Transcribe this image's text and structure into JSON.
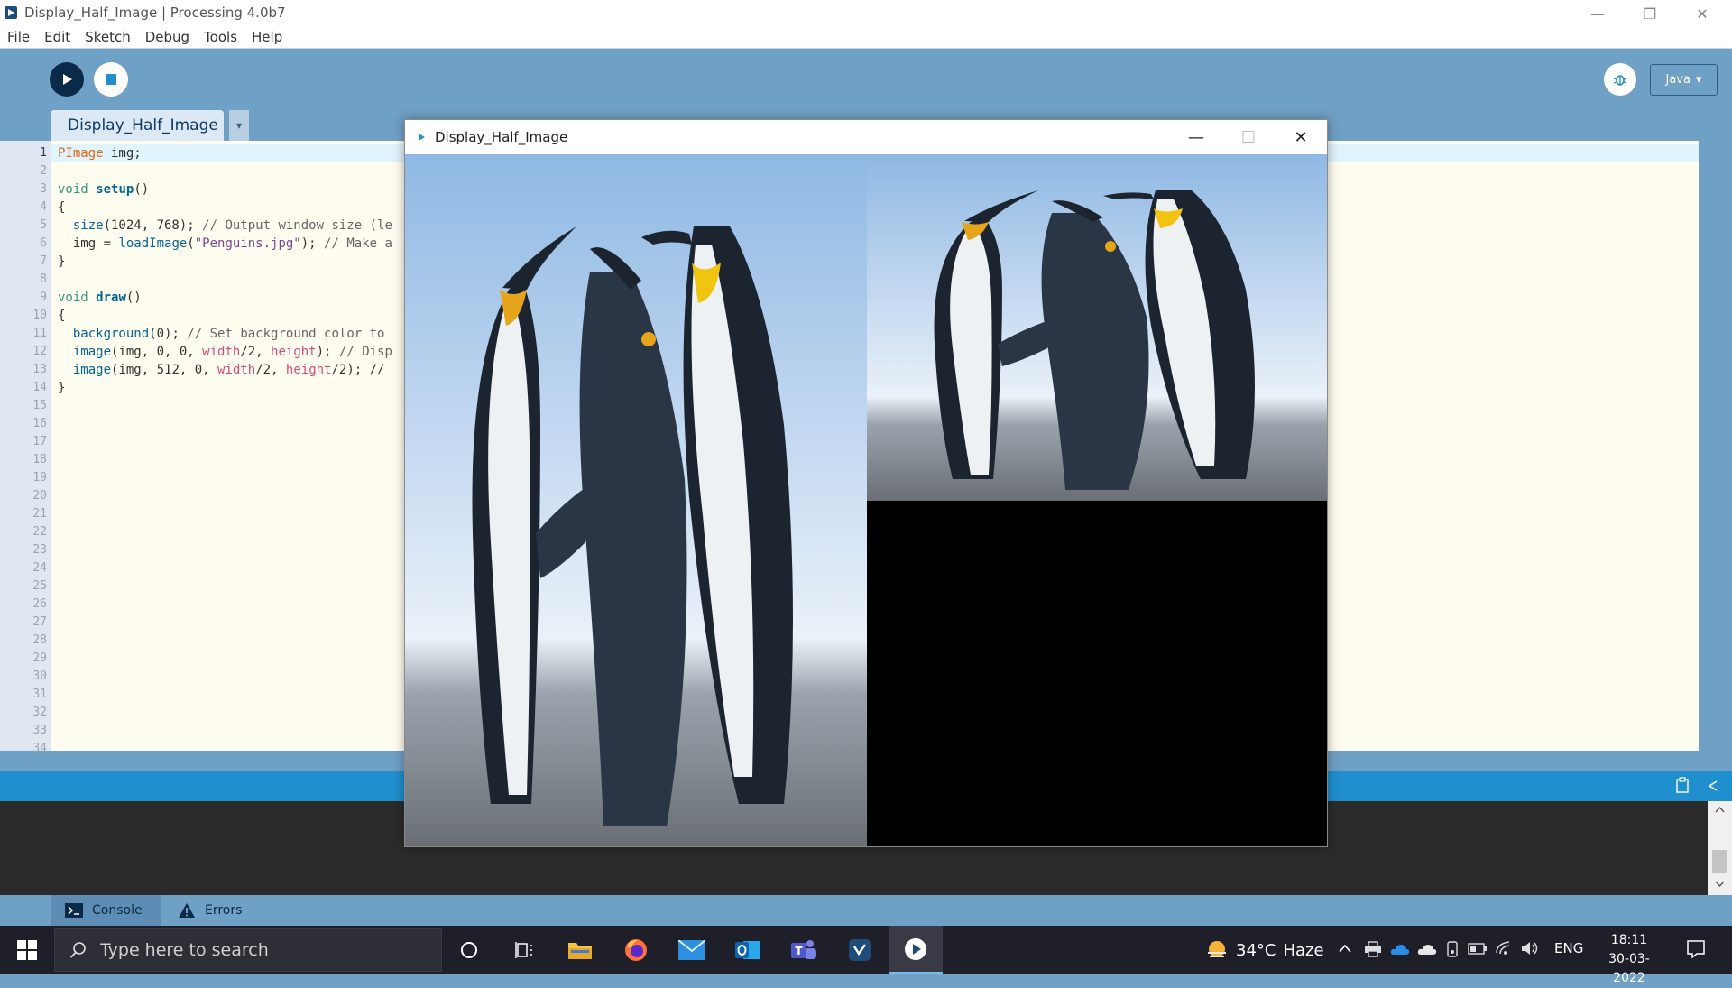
{
  "window": {
    "title": "Display_Half_Image | Processing 4.0b7",
    "minimize_glyph": "—",
    "restore_glyph": "❐",
    "close_glyph": "✕"
  },
  "menu": [
    "File",
    "Edit",
    "Sketch",
    "Debug",
    "Tools",
    "Help"
  ],
  "toolbar": {
    "run_icon": "play-icon",
    "stop_icon": "stop-icon",
    "debug_icon": "debug-icon",
    "mode_label": "Java",
    "mode_caret": "▾"
  },
  "editor_tab": {
    "label": "Display_Half_Image",
    "menu_caret": "▾"
  },
  "editor": {
    "line_numbers": [
      "1",
      "2",
      "3",
      "4",
      "5",
      "6",
      "7",
      "8",
      "9",
      "10",
      "11",
      "12",
      "13",
      "14",
      "15",
      "16",
      "17",
      "18",
      "19",
      "20",
      "21",
      "22",
      "23",
      "24",
      "25",
      "26",
      "27",
      "28",
      "29",
      "30",
      "31",
      "32",
      "33",
      "34"
    ],
    "code": {
      "l1a": "PImage",
      "l1b": " img;",
      "l3a": "void",
      "l3b": " ",
      "l3c": "setup",
      "l3d": "()",
      "l4": "{",
      "l5a": "  ",
      "l5b": "size",
      "l5c": "(1024, 768); ",
      "l5d": "// Output window size (le",
      "l6a": "  img = ",
      "l6b": "loadImage",
      "l6c": "(",
      "l6d": "\"Penguins.jpg\"",
      "l6e": "); ",
      "l6f": "// Make a",
      "l7": "}",
      "l9a": "void",
      "l9b": " ",
      "l9c": "draw",
      "l9d": "()",
      "l10": "{",
      "l11a": "  ",
      "l11b": "background",
      "l11c": "(0); ",
      "l11d": "// Set background color to",
      "l12a": "  ",
      "l12b": "image",
      "l12c": "(img, 0, 0, ",
      "l12d": "width",
      "l12e": "/2, ",
      "l12f": "height",
      "l12g": "); ",
      "l12h": "// Disp",
      "l13a": "  ",
      "l13b": "image",
      "l13c": "(img, 512, 0, ",
      "l13d": "width",
      "l13e": "/2, ",
      "l13f": "height",
      "l13g": "/2); //",
      "l14": "}"
    }
  },
  "footer_tabs": {
    "console": "Console",
    "errors": "Errors"
  },
  "sketch_window": {
    "title": "Display_Half_Image",
    "minimize_glyph": "—",
    "maximize_glyph": "☐",
    "close_glyph": "✕"
  },
  "taskbar": {
    "search_placeholder": "Type here to search",
    "weather_temp": "34°C",
    "weather_desc": "Haze",
    "language": "ENG",
    "time": "18:11",
    "date": "30-03-2022"
  },
  "colors": {
    "accent": "#1f8fce",
    "toolbar_bg": "#6fa0c6",
    "run_button": "#0b2948"
  }
}
